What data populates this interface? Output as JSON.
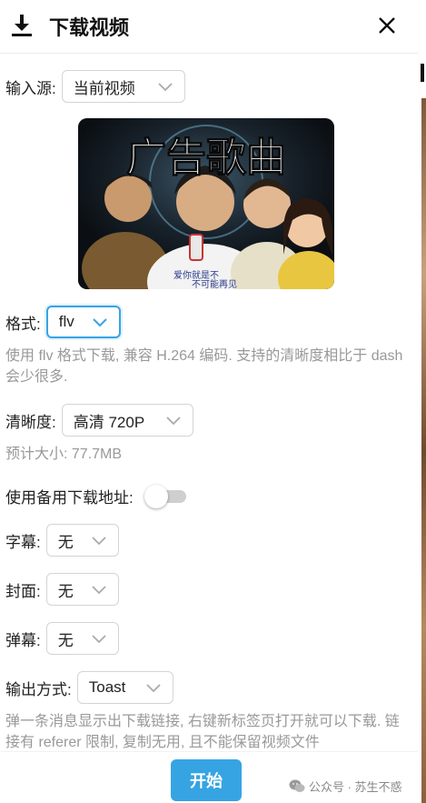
{
  "header": {
    "title": "下载视频"
  },
  "input_source": {
    "label": "输入源:",
    "value": "当前视频"
  },
  "cover": {
    "title_text": "广告歌曲",
    "shirt_text_line1": "爱你就是不",
    "shirt_text_line2": "不可能再见"
  },
  "format": {
    "label": "格式:",
    "value": "flv",
    "hint": "使用 flv 格式下载, 兼容 H.264 编码. 支持的清晰度相比于 dash 会少很多."
  },
  "quality": {
    "label": "清晰度:",
    "value": "高清 720P",
    "estimate": "预计大小: 77.7MB"
  },
  "backup_url": {
    "label": "使用备用下载地址:",
    "enabled": false
  },
  "subtitle": {
    "label": "字幕:",
    "value": "无"
  },
  "cover_option": {
    "label": "封面:",
    "value": "无"
  },
  "danmaku": {
    "label": "弹幕:",
    "value": "无"
  },
  "output": {
    "label": "输出方式:",
    "value": "Toast",
    "hint": "弹一条消息显示出下载链接, 右键新标签页打开就可以下载. 链接有 referer 限制, 复制无用, 且不能保留视频文件"
  },
  "footer": {
    "start_label": "开始",
    "watermark": "公众号 · 苏生不惑"
  },
  "colors": {
    "accent": "#36a4e3",
    "hint_text": "#999999"
  },
  "icons": [
    "download-icon",
    "close-icon",
    "chevron-down-icon",
    "wechat-icon"
  ]
}
